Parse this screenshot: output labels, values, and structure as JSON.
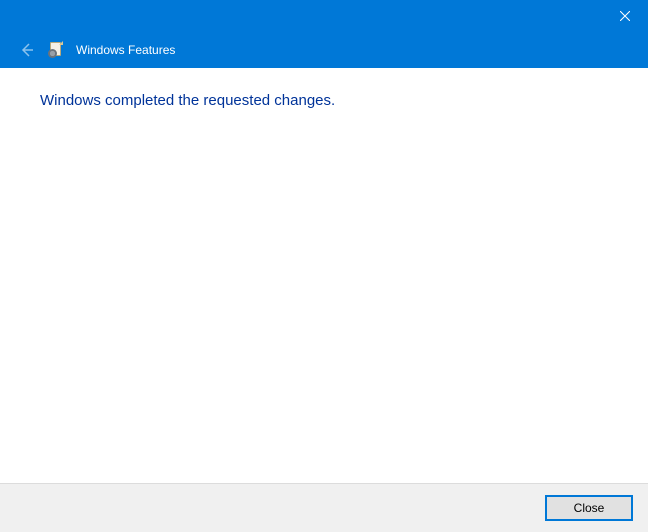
{
  "titlebar": {
    "close_tooltip": "Close"
  },
  "header": {
    "title": "Windows Features"
  },
  "content": {
    "message": "Windows completed the requested changes."
  },
  "footer": {
    "close_label": "Close"
  }
}
